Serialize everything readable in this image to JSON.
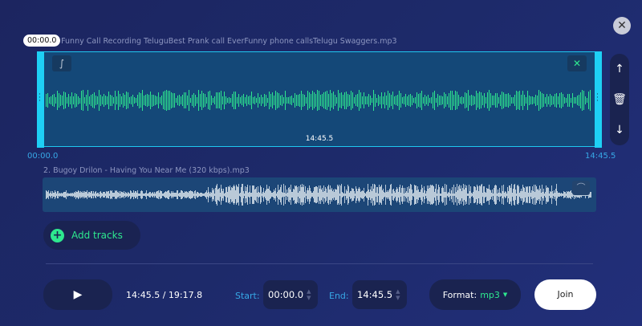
{
  "close_label": "✕",
  "track1": {
    "name": "1. Funny Call Recording TeluguBest Prank call EverFunny phone callsTelugu Swaggers.mp3",
    "playhead": "00:00.0",
    "duration": "14:45.5",
    "start": "00:00.0",
    "end": "14:45.5",
    "fade_in_icon": "fade-in-icon",
    "shuffle_icon": "crossfade-icon",
    "wave_color": "#2ee88f"
  },
  "track2": {
    "name": "2. Bugoy Drilon - Having You Near Me (320 kbps).mp3",
    "wave_color": "#b9c9d8"
  },
  "add_tracks": "Add tracks",
  "controls": {
    "time": "14:45.5 / 19:17.8",
    "start_label": "Start:",
    "start_value": "00:00.0",
    "end_label": "End:",
    "end_value": "14:45.5",
    "format_label": "Format:",
    "format_value": "mp3",
    "join": "Join"
  },
  "colors": {
    "accent": "#1ed0f5",
    "green": "#2ee88f",
    "label_blue": "#37a8e6"
  }
}
